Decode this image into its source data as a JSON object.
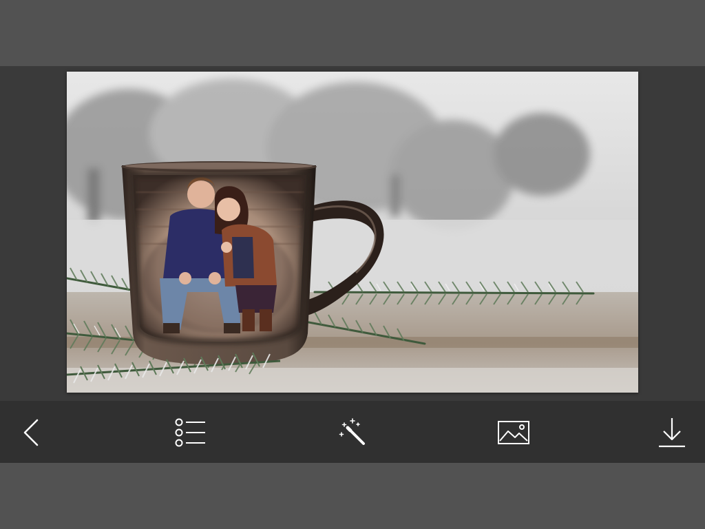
{
  "app": {
    "colors": {
      "top_bar": "#525252",
      "editor_background": "#3a3a3a",
      "toolbar": "#303030",
      "icon": "#ffffff"
    }
  },
  "canvas": {
    "image": "couple-in-coffee-mug-winter-frame",
    "description_icon": "photo-canvas"
  },
  "toolbar": {
    "items": [
      {
        "icon": "back-icon"
      },
      {
        "icon": "frame-list-icon"
      },
      {
        "icon": "magic-wand-icon"
      },
      {
        "icon": "gallery-image-icon"
      },
      {
        "icon": "download-icon"
      }
    ]
  }
}
